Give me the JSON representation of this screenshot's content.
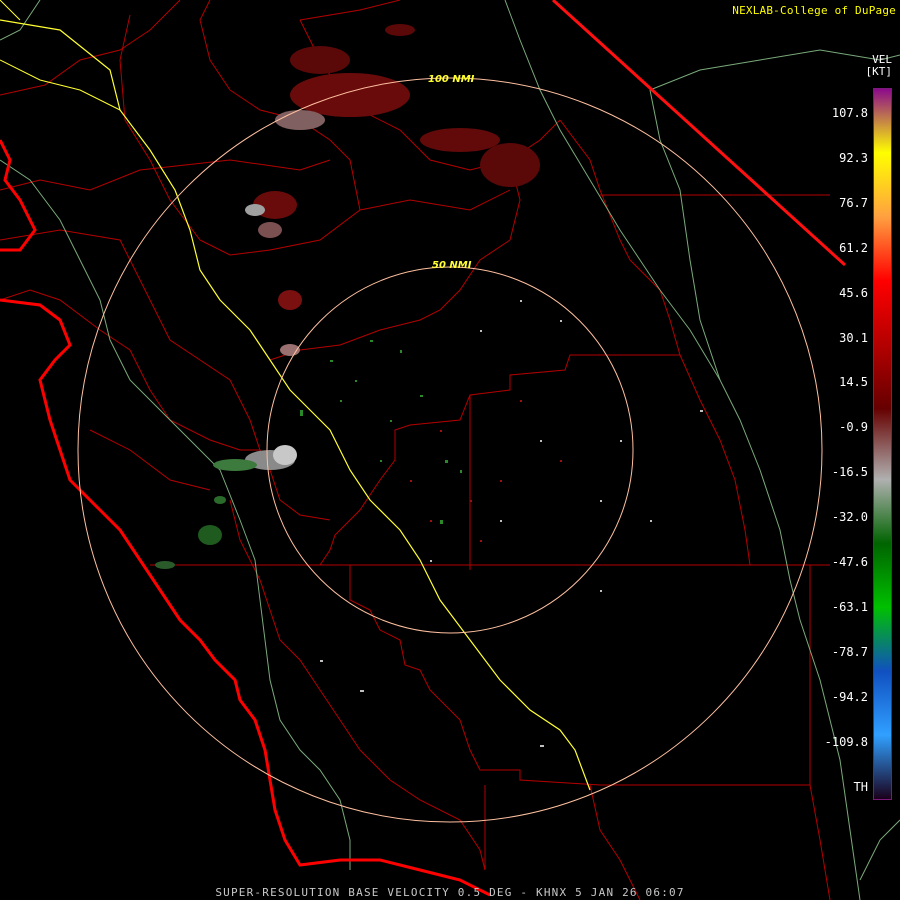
{
  "credit": "NEXLAB-College of DuPage",
  "caption": "SUPER-RESOLUTION BASE VELOCITY 0.5 DEG - KHNX 5 JAN 26 06:07",
  "range_rings": [
    {
      "label": "50 NMI"
    },
    {
      "label": "100 NMI"
    }
  ],
  "legend": {
    "product": "VEL",
    "unit": "[KT]",
    "ticks": [
      "107.8",
      "92.3",
      "76.7",
      "61.2",
      "45.6",
      "30.1",
      "14.5",
      "-0.9",
      "-16.5",
      "-32.0",
      "-47.6",
      "-63.1",
      "-78.7",
      "-94.2",
      "-109.8",
      "TH"
    ],
    "colors": [
      "#8b0a8b",
      "#ffff00",
      "#ffa040",
      "#ff0000",
      "#b40000",
      "#660000",
      "#b0b0b0",
      "#006400",
      "#00c000",
      "#1050c0",
      "#30a0ff",
      "#1a001a"
    ]
  },
  "map_colors": {
    "coast": "#ff0000",
    "county": "#b40000",
    "highway": "#ffff33",
    "state_border": "#ff1010",
    "range_ring": "#ffc0a0"
  }
}
